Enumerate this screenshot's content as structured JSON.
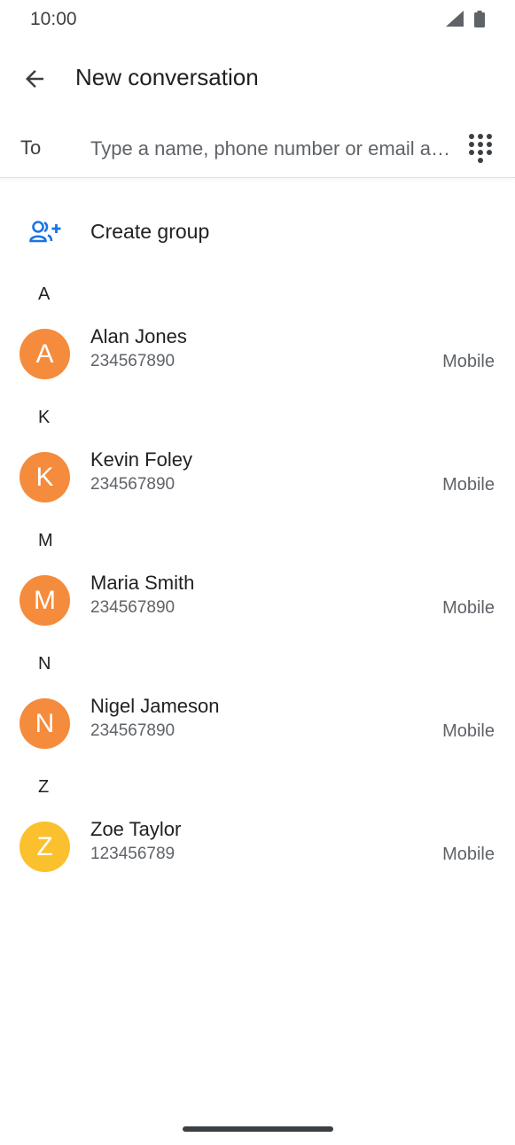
{
  "status_bar": {
    "time": "10:00",
    "signal_icon": "cellular-signal-icon",
    "battery_icon": "battery-icon"
  },
  "app_bar": {
    "back_icon": "arrow-back-icon",
    "title": "New conversation"
  },
  "recipient": {
    "label": "To",
    "value": "",
    "placeholder": "Type a name, phone number or email a…",
    "dialpad_icon": "dialpad-icon"
  },
  "create_group": {
    "icon": "add-group-icon",
    "label": "Create group",
    "accent": "#1a73e8"
  },
  "contacts": [
    {
      "section": "A",
      "initial": "A",
      "name": "Alan Jones",
      "number": "234567890",
      "type": "Mobile",
      "color": "#f58b3c"
    },
    {
      "section": "K",
      "initial": "K",
      "name": "Kevin Foley",
      "number": "234567890",
      "type": "Mobile",
      "color": "#f58b3c"
    },
    {
      "section": "M",
      "initial": "M",
      "name": "Maria Smith",
      "number": "234567890",
      "type": "Mobile",
      "color": "#f58b3c"
    },
    {
      "section": "N",
      "initial": "N",
      "name": "Nigel Jameson",
      "number": "234567890",
      "type": "Mobile",
      "color": "#f58b3c"
    },
    {
      "section": "Z",
      "initial": "Z",
      "name": "Zoe Taylor",
      "number": "123456789",
      "type": "Mobile",
      "color": "#fbc02d"
    }
  ]
}
